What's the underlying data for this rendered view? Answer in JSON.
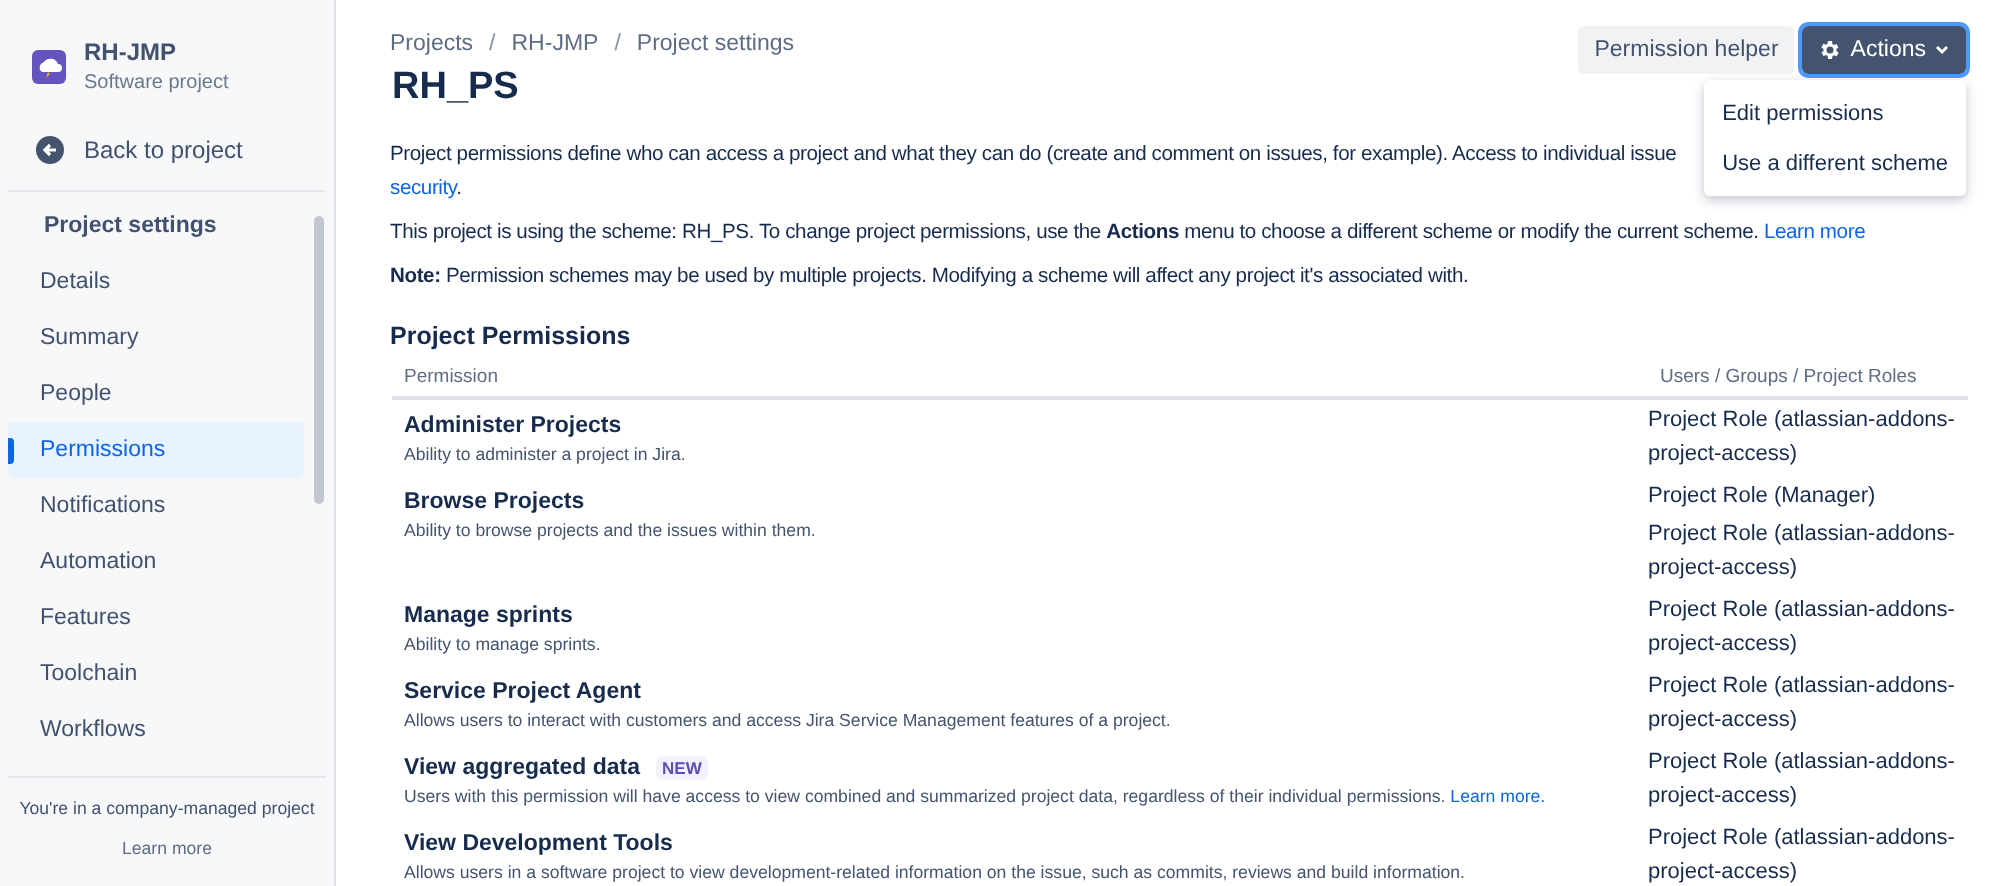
{
  "sidebar": {
    "project": {
      "name": "RH-JMP",
      "type": "Software project"
    },
    "back": "Back to project",
    "heading": "Project settings",
    "items": [
      {
        "label": "Details",
        "selected": false
      },
      {
        "label": "Summary",
        "selected": false
      },
      {
        "label": "People",
        "selected": false
      },
      {
        "label": "Permissions",
        "selected": true
      },
      {
        "label": "Notifications",
        "selected": false
      },
      {
        "label": "Automation",
        "selected": false
      },
      {
        "label": "Features",
        "selected": false
      },
      {
        "label": "Toolchain",
        "selected": false
      },
      {
        "label": "Workflows",
        "selected": false
      }
    ],
    "footer": {
      "text": "You're in a company-managed project",
      "link": "Learn more"
    }
  },
  "breadcrumbs": [
    {
      "kind": "link",
      "text": "Projects"
    },
    {
      "kind": "separator",
      "text": "/"
    },
    {
      "kind": "link",
      "text": "RH-JMP"
    },
    {
      "kind": "separator",
      "text": "/"
    },
    {
      "kind": "link",
      "text": "Project settings"
    }
  ],
  "title": "RH_PS",
  "buttons": {
    "helper": "Permission helper",
    "actions": "Actions"
  },
  "actions_menu": {
    "expanded": true,
    "items": [
      "Edit permissions",
      "Use a different scheme"
    ]
  },
  "intro": {
    "text": "Project permissions define who can access a project and what they can do (create and comment on issues, for example). Access to individual issue",
    "link": "security",
    "after": "."
  },
  "scheme_note": {
    "text": "This project is using the scheme: RH_PS. To change project permissions, use the **Actions** menu to choose a different scheme or modify the current scheme.",
    "link": "Learn more"
  },
  "note": "**Note:** Permission schemes may be used by multiple projects. Modifying a scheme will affect any project it's associated with.",
  "table": {
    "title": "Project Permissions",
    "columns": [
      "Permission",
      "Users / Groups / Project Roles"
    ],
    "rows": [
      {
        "name": "Administer Projects",
        "description": "Ability to administer a project in Jira.",
        "roles": [
          "Project Role (atlassian-addons-project-access)"
        ]
      },
      {
        "name": "Browse Projects",
        "description": "Ability to browse projects and the issues within them.",
        "roles": [
          "Project Role (Manager)",
          "Project Role (atlassian-addons-project-access)"
        ]
      },
      {
        "name": "Manage sprints",
        "description": "Ability to manage sprints.",
        "roles": [
          "Project Role (atlassian-addons-project-access)"
        ]
      },
      {
        "name": "Service Project Agent",
        "description": "Allows users to interact with customers and access Jira Service Management features of a project.",
        "roles": [
          "Project Role (atlassian-addons-project-access)"
        ]
      },
      {
        "name": "View aggregated data",
        "badge": "NEW",
        "description": "Users with this permission will have access to view combined and summarized project data, regardless of their individual permissions.",
        "link": "Learn more.",
        "roles": [
          "Project Role (atlassian-addons-project-access)"
        ]
      },
      {
        "name": "View Development Tools",
        "description": "Allows users in a software project to view development-related information on the issue, such as commits, reviews and build information.",
        "roles": [
          "Project Role (atlassian-addons-project-access)"
        ]
      }
    ]
  }
}
